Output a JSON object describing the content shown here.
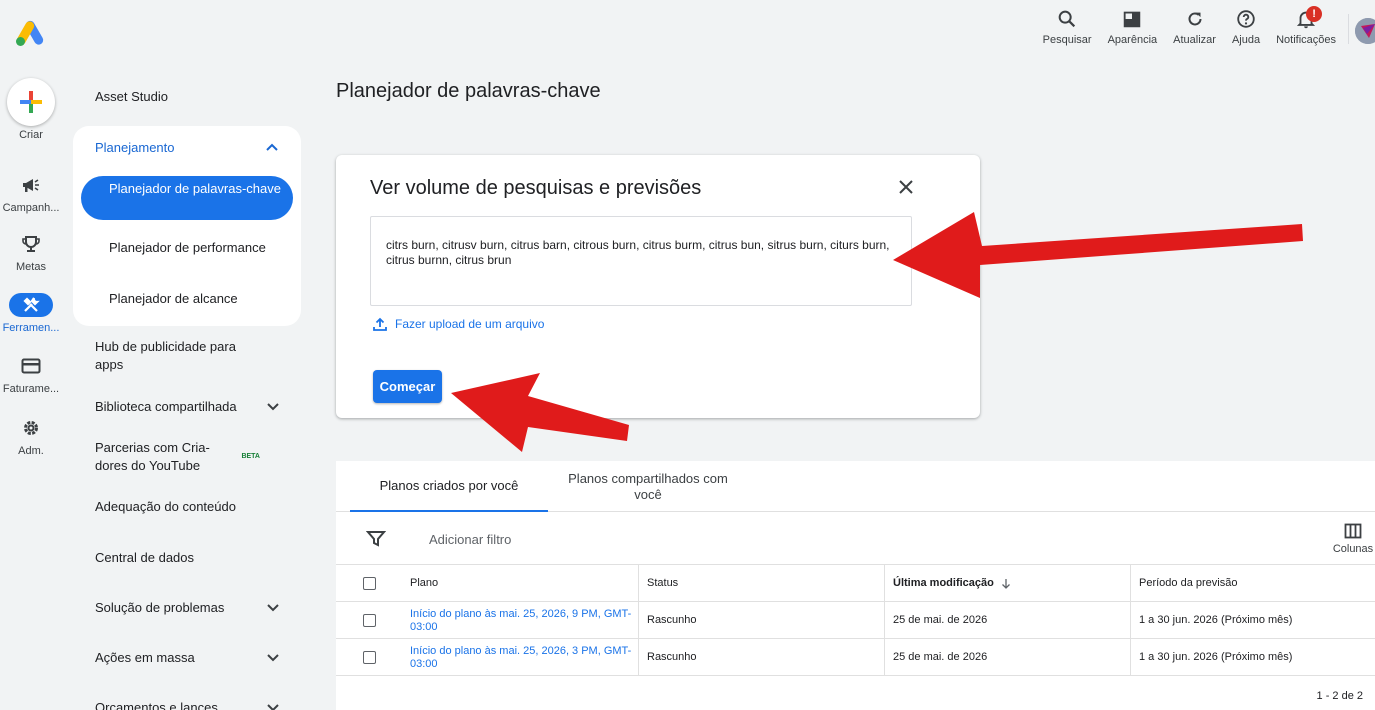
{
  "topbar": {
    "actions": [
      {
        "label": "Pesquisar"
      },
      {
        "label": "Aparência"
      },
      {
        "label": "Atualizar"
      },
      {
        "label": "Ajuda"
      },
      {
        "label": "Notificações",
        "badge": "!"
      }
    ]
  },
  "rail": {
    "create_label": "Criar",
    "items": [
      {
        "label": "Campanh..."
      },
      {
        "label": "Metas"
      },
      {
        "label": "Ferramen..."
      },
      {
        "label": "Faturame..."
      },
      {
        "label": "Adm."
      }
    ]
  },
  "nav": {
    "asset_studio": "Asset Studio",
    "group_title": "Planejamento",
    "sub": [
      "Planejador de palavras-chave",
      "Planejador de performance",
      "Planejador de alcance"
    ],
    "items": [
      "Hub de publicidade para apps",
      "Biblioteca compartilhada",
      "Parcerias com Cria-dores do YouTube",
      "Adequação do conteúdo",
      "Central de dados",
      "Solução de problemas",
      "Ações em massa",
      "Orçamentos e lances"
    ],
    "beta": "BETA"
  },
  "main": {
    "title": "Planejador de palavras-chave",
    "card": {
      "title": "Ver volume de pesquisas e previsões",
      "keywords": "citrs burn, citrusv burn, citrus barn, citrous burn, citrus burm, citrus bun, sitrus burn, citurs burn, citrus burnn, citrus brun",
      "upload": "Fazer upload de um arquivo",
      "start": "Começar"
    },
    "tabs": [
      "Planos criados por você",
      "Planos compartilhados com você"
    ],
    "filter": "Adicionar filtro",
    "columns_label": "Colunas",
    "headers": [
      "Plano",
      "Status",
      "Última modificação",
      "Período da previsão"
    ],
    "rows": [
      {
        "plan": "Início do plano às mai. 25, 2026, 9 PM, GMT-03:00",
        "status": "Rascunho",
        "modified": "25 de mai. de 2026",
        "period": "1 a 30 jun. 2026 (Próximo mês)"
      },
      {
        "plan": "Início do plano às mai. 25, 2026, 3 PM, GMT-03:00",
        "status": "Rascunho",
        "modified": "25 de mai. de 2026",
        "period": "1 a 30 jun. 2026 (Próximo mês)"
      }
    ],
    "pager": "1 - 2 de 2"
  },
  "colors": {
    "accent": "#1a73e8",
    "arrow": "#e01b1b",
    "notif": "#d93025"
  }
}
